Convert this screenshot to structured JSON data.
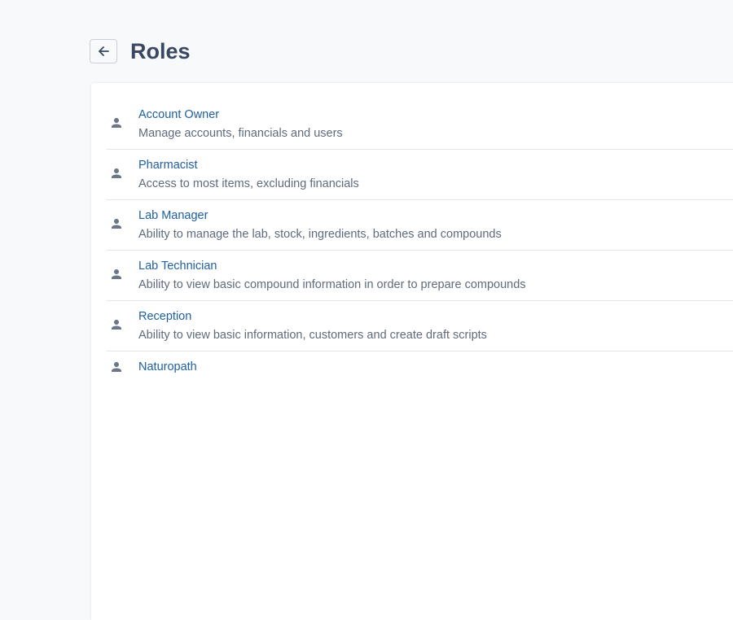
{
  "header": {
    "back_icon": "arrow-left-icon",
    "title": "Roles"
  },
  "roles": [
    {
      "name": "Account Owner",
      "description": "Manage accounts, financials and users",
      "icon": "person-icon"
    },
    {
      "name": "Pharmacist",
      "description": "Access to most items, excluding financials",
      "icon": "person-icon"
    },
    {
      "name": "Lab Manager",
      "description": "Ability to manage the lab, stock, ingredients, batches and compounds",
      "icon": "person-icon"
    },
    {
      "name": "Lab Technician",
      "description": "Ability to view basic compound information in order to prepare compounds",
      "icon": "person-icon"
    },
    {
      "name": "Reception",
      "description": "Ability to view basic information, customers and create draft scripts",
      "icon": "person-icon"
    },
    {
      "name": "Naturopath",
      "description": "",
      "icon": "person-icon"
    }
  ],
  "colors": {
    "title": "#394860",
    "link": "#1f5fa3",
    "description": "#5f6b7b",
    "icon": "#6b7686",
    "background": "#f8f9fb"
  }
}
